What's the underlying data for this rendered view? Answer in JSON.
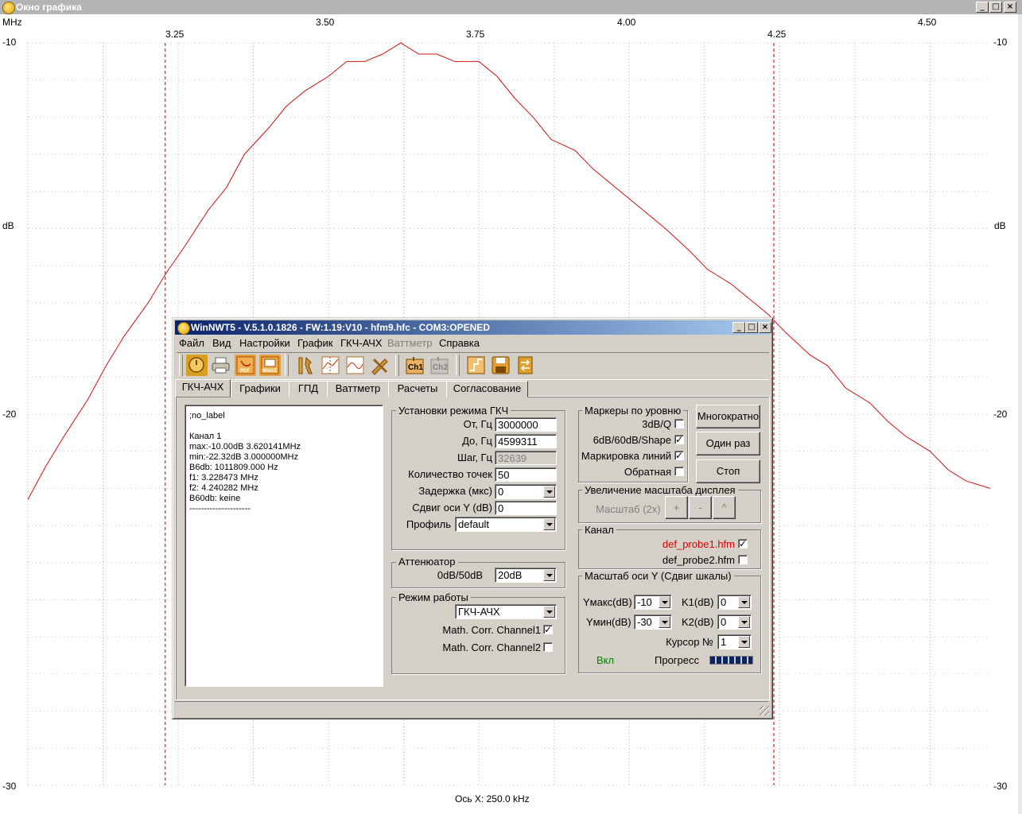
{
  "outer_window": {
    "title": "Окно графика"
  },
  "graph": {
    "x_unit": "MHz",
    "y_unit_left": "dB",
    "y_unit_right": "dB",
    "top_ticks": [
      "3.50",
      "4.00",
      "4.50"
    ],
    "bottom_ticks": [
      "3.25",
      "3.75",
      "4.25"
    ],
    "y_ticks_left": [
      "-10",
      "-20",
      "-30"
    ],
    "y_ticks_right": [
      "-10",
      "-20",
      "-30"
    ],
    "x_axis_info": "Ось X: 250.0 kHz",
    "curve_color": "#d01010",
    "marker_color": "#c00000"
  },
  "chart_data": {
    "type": "line",
    "xlabel": "MHz",
    "ylabel": "dB",
    "xlim": [
      3.0,
      4.6
    ],
    "ylim": [
      -30,
      -10
    ],
    "markers_mhz": [
      3.228473,
      4.240282
    ],
    "series": [
      {
        "x": [
          3.0,
          3.03,
          3.06,
          3.1,
          3.13,
          3.16,
          3.2,
          3.23,
          3.26,
          3.3,
          3.33,
          3.36,
          3.4,
          3.43,
          3.46,
          3.5,
          3.53,
          3.56,
          3.59,
          3.62,
          3.65,
          3.68,
          3.71,
          3.75,
          3.78,
          3.81,
          3.84,
          3.87,
          3.91,
          3.94,
          3.97,
          4.0,
          4.03,
          4.06,
          4.1,
          4.13,
          4.17,
          4.2,
          4.23,
          4.26,
          4.3,
          4.33,
          4.36,
          4.4,
          4.43,
          4.46,
          4.5,
          4.53,
          4.56,
          4.6
        ],
        "y": [
          -22.3,
          -21.4,
          -20.6,
          -19.6,
          -18.7,
          -17.9,
          -17.0,
          -16.2,
          -15.5,
          -14.5,
          -13.9,
          -13.0,
          -12.3,
          -11.7,
          -11.3,
          -10.9,
          -10.5,
          -10.5,
          -10.3,
          -10.0,
          -10.3,
          -10.3,
          -10.5,
          -10.5,
          -10.9,
          -11.5,
          -12.0,
          -12.6,
          -12.9,
          -13.4,
          -13.8,
          -14.2,
          -14.6,
          -15.0,
          -15.6,
          -16.1,
          -16.5,
          -16.9,
          -17.3,
          -17.8,
          -18.4,
          -18.7,
          -19.3,
          -19.7,
          -20.2,
          -20.6,
          -21.0,
          -21.5,
          -21.8,
          -22.0
        ]
      }
    ]
  },
  "dialog": {
    "title": "WinNWT5 - V.5.1.0.1826 - FW:1.19:V10 - hfm9.hfc - COM3:OPENED",
    "menu": [
      "Файл",
      "Вид",
      "Настройки",
      "График",
      "ГКЧ-АЧХ",
      "Ваттметр",
      "Справка"
    ],
    "toolbar_icons": [
      "power-icon",
      "print-icon",
      "pdf-icon",
      "image-icon",
      "settings-icon",
      "graph-icon",
      "curve-icon",
      "tools-icon",
      "ch1-icon",
      "ch2-icon",
      "sweep-icon",
      "save-icon",
      "exchange-icon"
    ],
    "toolbar_labels": {
      "pdf": "PDF",
      "image": "IMAGE",
      "ch1": "Ch1",
      "ch2": "Ch2"
    },
    "tabs": [
      "ГКЧ-АЧХ",
      "Графики",
      "ГПД",
      "Ваттметр",
      "Расчеты",
      "Согласование"
    ],
    "memo": ";no_label\n\nКанал 1\nmax:-10.00dB 3.620141MHz\nmin:-22.32dB 3.000000MHz\nB6db: 1011809.000 Hz\nf1: 3.228473 MHz\nf2: 4.240282 MHz\nB60db: keine\n---------------------",
    "sweep": {
      "title": "Установки режима ГКЧ",
      "from_label": "От, Гц",
      "from_value": "3000000",
      "to_label": "До, Гц",
      "to_value": "4599311",
      "step_label": "Шаг, Гц",
      "step_value": "32639",
      "points_label": "Количество точек",
      "points_value": "50",
      "delay_label": "Задержка (мкс)",
      "delay_value": "0",
      "yshift_label": "Сдвиг оси Y (dB)",
      "yshift_value": "0",
      "profile_label": "Профиль",
      "profile_value": "default"
    },
    "attenuator": {
      "title": "Аттенюатор",
      "label": "0dB/50dB",
      "value": "20dB"
    },
    "mode": {
      "title": "Режим работы",
      "value": "ГКЧ-АЧХ",
      "corr1": "Math. Corr. Channel1",
      "corr2": "Math. Corr. Channel2"
    },
    "markers": {
      "title": "Маркеры по уровню",
      "q3db": "3dB/Q",
      "shape": "6dB/60dB/Shape",
      "lines": "Маркировка линий",
      "reverse": "Обратная"
    },
    "buttons": {
      "multi": "Многократно",
      "once": "Один раз",
      "stop": "Стоп"
    },
    "zoom": {
      "title": "Увеличение масштаба дисплея",
      "scale": "Масштаб (2x)",
      "plus": "+",
      "minus": "-",
      "up": "^"
    },
    "channel": {
      "title": "Канал",
      "probe1": "def_probe1.hfm",
      "probe2": "def_probe2.hfm"
    },
    "yscale": {
      "title": "Масштаб оси Y (Сдвиг шкалы)",
      "ymax_label": "Yмакс(dB)",
      "ymax_value": "-10",
      "ymin_label": "Yмин(dB)",
      "ymin_value": "-30",
      "k1_label": "K1(dB)",
      "k1_value": "0",
      "k2_label": "K2(dB)",
      "k2_value": "0",
      "cursor_label": "Курсор №",
      "cursor_value": "1",
      "on_label": "Вкл",
      "progress_label": "Прогресс"
    }
  }
}
